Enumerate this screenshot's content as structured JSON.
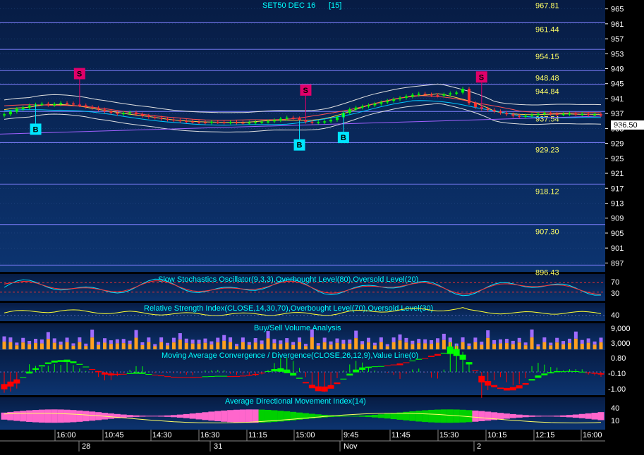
{
  "chart_data": [
    {
      "type": "candlestick",
      "title": "SET50 DEC 16",
      "interval": "[15]",
      "last_price": "936.50",
      "ylim": [
        895,
        967
      ],
      "yticks": [
        965,
        961,
        957,
        953,
        949,
        945,
        941,
        937,
        933,
        929,
        925,
        921,
        917,
        913,
        909,
        905,
        901,
        897
      ],
      "levels": [
        {
          "label": "967.81",
          "value": 967.81
        },
        {
          "label": "961.44",
          "value": 961.44
        },
        {
          "label": "954.15",
          "value": 954.15
        },
        {
          "label": "948.48",
          "value": 948.48
        },
        {
          "label": "944.84",
          "value": 944.84
        },
        {
          "label": "937.54",
          "value": 937.54
        },
        {
          "label": "929.23",
          "value": 929.23
        },
        {
          "label": "918.12",
          "value": 918.12
        },
        {
          "label": "907.30",
          "value": 907.3
        },
        {
          "label": "896.43",
          "value": 896.43
        }
      ],
      "close": [
        936.8,
        937.5,
        938.2,
        938.6,
        939.1,
        939.4,
        939.6,
        939.3,
        939.5,
        939.8,
        939.7,
        939.4,
        939.2,
        938.8,
        938.5,
        938.1,
        937.6,
        937.2,
        936.9,
        937.1,
        937.3,
        936.8,
        936.4,
        936.1,
        935.9,
        935.6,
        935.4,
        935.2,
        935.0,
        934.9,
        934.8,
        934.7,
        934.6,
        934.8,
        934.7,
        934.6,
        934.7,
        934.6,
        934.5,
        934.6,
        934.7,
        934.8,
        934.9,
        935.2,
        935.6,
        935.9,
        935.7,
        935.2,
        934.8,
        934.6,
        934.7,
        934.9,
        935.3,
        936.0,
        937.2,
        938.1,
        938.6,
        938.9,
        939.2,
        939.6,
        940.0,
        940.4,
        940.8,
        941.2,
        941.6,
        942.0,
        942.3,
        942.1,
        941.9,
        941.8,
        942.1,
        942.4,
        942.6,
        943.6,
        939.8,
        938.7,
        938.3,
        938.0,
        937.6,
        937.2,
        936.8,
        936.4,
        936.2,
        936.4,
        936.7,
        936.9,
        937.1,
        936.9,
        936.8,
        936.9,
        937.0,
        936.8,
        936.9,
        936.7,
        936.8,
        936.6
      ],
      "signals": [
        {
          "label": "S",
          "type": "sell",
          "index": 12
        },
        {
          "label": "B",
          "type": "buy",
          "index": 5
        },
        {
          "label": "S",
          "type": "sell",
          "index": 48
        },
        {
          "label": "B",
          "type": "buy",
          "index": 47
        },
        {
          "label": "B",
          "type": "buy",
          "index": 54
        },
        {
          "label": "S",
          "type": "sell",
          "index": 76
        }
      ]
    },
    {
      "type": "line",
      "title": "Slow Stochastics Oscillator(9,3,3),Overbought Level(80),Oversold Level(20)",
      "yticks": [
        70,
        30
      ],
      "ylim": [
        0,
        100
      ]
    },
    {
      "type": "line",
      "title": "Relative Strength Index(CLOSE,14,30,70),Overbought Level(70),Oversold Level(30)",
      "yticks": [
        40
      ],
      "ylim": [
        30,
        70
      ]
    },
    {
      "type": "bar",
      "title": "Buy/Sell Volume Analysis",
      "ytick_labels": [
        "9,000",
        "3,000"
      ],
      "ylim": [
        0,
        12000
      ]
    },
    {
      "type": "area",
      "title": "Moving Average Convergence / Divergence(CLOSE,26,12,9),Value Line(0)",
      "ytick_labels": [
        "0.80",
        "-0.10",
        "-1.00"
      ],
      "ylim": [
        -1.5,
        1.2
      ]
    },
    {
      "type": "area",
      "title": "Average Directional Movement Index(14)",
      "yticks": [
        40,
        10
      ],
      "ylim": [
        0,
        55
      ]
    }
  ],
  "xaxis": {
    "time_labels": [
      "16:00",
      "10:45",
      "14:30",
      "16:30",
      "11:15",
      "15:00",
      "9:45",
      "11:45",
      "15:30",
      "10:15",
      "12:15",
      "16:00"
    ],
    "date_labels": [
      "28",
      "31",
      "Nov",
      "2"
    ]
  },
  "colors": {
    "background": "#0b2f66",
    "grid": "#2b4f8c",
    "level_line": "#7f7fff",
    "level_label": "#ffff66",
    "title_text": "#00ffff",
    "buy_marker": "#00e5ff",
    "sell_marker": "#e0006a",
    "candle_up": "#00ff00",
    "candle_down": "#ff3030",
    "macd_pos": "#00ff00",
    "macd_neg": "#ff0000",
    "adx_pos": "#00d000",
    "adx_neg": "#ff66cc"
  }
}
